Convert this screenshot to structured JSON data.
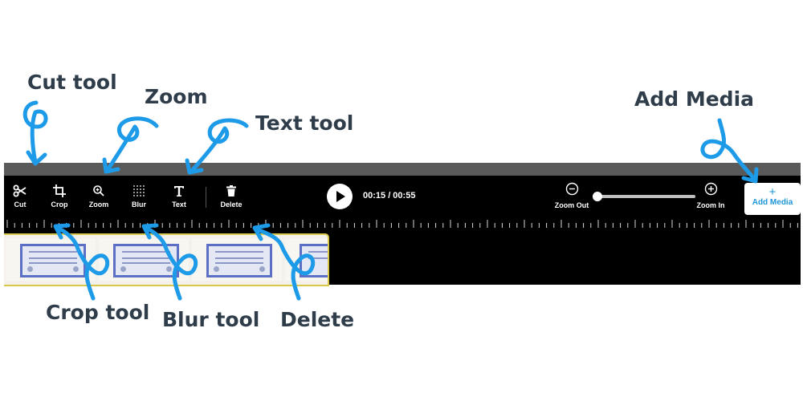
{
  "callouts": {
    "cut_tool": "Cut tool",
    "zoom": "Zoom",
    "text_tool": "Text tool",
    "add_media": "Add Media",
    "crop_tool": "Crop tool",
    "blur_tool": "Blur tool",
    "delete": "Delete"
  },
  "toolbar": {
    "tools": [
      {
        "label": "Cut",
        "icon": "scissors-icon"
      },
      {
        "label": "Crop",
        "icon": "crop-icon"
      },
      {
        "label": "Zoom",
        "icon": "zoom-in-magnifier-icon"
      },
      {
        "label": "Blur",
        "icon": "blur-grid-icon"
      },
      {
        "label": "Text",
        "icon": "text-t-icon"
      },
      {
        "label": "Delete",
        "icon": "trash-icon"
      }
    ],
    "play_icon": "play-icon",
    "time": "00:15 / 00:55",
    "zoom_out_label": "Zoom Out",
    "zoom_in_label": "Zoom In",
    "add_media_plus": "+",
    "add_media_label": "Add Media"
  },
  "colors": {
    "callout_text": "#2f3d4b",
    "annotation_arrow": "#1e9be8",
    "toolbar_bg": "#000000",
    "top_bar": "#5a5a5a",
    "accent_blue": "#1e96d8",
    "clip_border": "#d8c84a"
  }
}
